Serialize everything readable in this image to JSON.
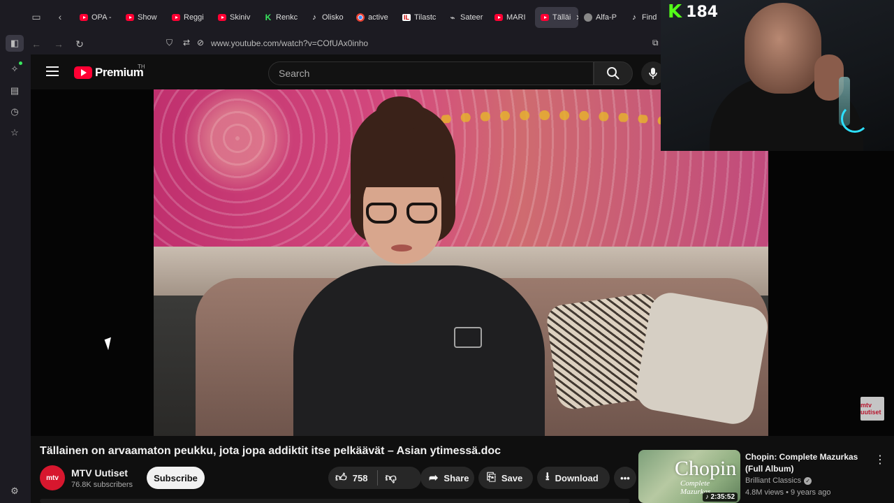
{
  "browser": {
    "tabs": [
      {
        "label": "OPA -",
        "icon": "youtube-icon"
      },
      {
        "label": "Show",
        "icon": "youtube-icon"
      },
      {
        "label": "Reggi",
        "icon": "youtube-icon"
      },
      {
        "label": "Skiniv",
        "icon": "youtube-icon"
      },
      {
        "label": "Renkc",
        "icon": "kick-icon"
      },
      {
        "label": "Olisko",
        "icon": "tiktok-icon"
      },
      {
        "label": "active",
        "icon": "chrome-icon"
      },
      {
        "label": "Tilastc",
        "icon": "il-icon"
      },
      {
        "label": "Sateer",
        "icon": "satellite-icon"
      },
      {
        "label": "MARI",
        "icon": "youtube-icon"
      },
      {
        "label": "Tälläi",
        "icon": "youtube-icon",
        "active": true
      },
      {
        "label": "Alfa-P",
        "icon": "alfa-icon"
      },
      {
        "label": "Find",
        "icon": "tiktok-icon"
      }
    ],
    "url": "www.youtube.com/watch?v=COfUAx0inho"
  },
  "youtube": {
    "logo_text": "Premium",
    "country_code": "TH",
    "search_placeholder": "Search"
  },
  "video": {
    "title": "Tällainen on arvaamaton peukku, jota jopa addiktit itse pelkäävät – Asian ytimessä.doc",
    "watermark": "mtv uutiset"
  },
  "channel": {
    "avatar_text": "mtv",
    "name": "MTV Uutiset",
    "subscribers": "76.8K subscribers",
    "subscribe_label": "Subscribe"
  },
  "actions": {
    "likes": "758",
    "share": "Share",
    "save": "Save",
    "download": "Download"
  },
  "overlay": {
    "kick_logo": "K",
    "viewer_count": "184"
  },
  "recommendation": {
    "thumb_title": "Chopin",
    "thumb_subtitle": "Complete Mazurkas",
    "duration": "2:35:52",
    "title": "Chopin: Complete Mazurkas (Full Album)",
    "channel": "Brilliant Classics",
    "meta": "4.8M views • 9 years ago"
  }
}
